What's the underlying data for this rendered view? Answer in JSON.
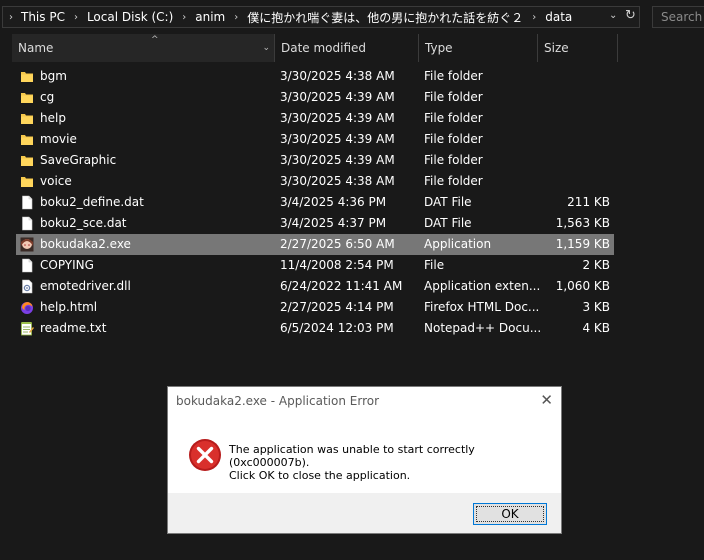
{
  "address": {
    "crumbs": [
      "This PC",
      "Local Disk (C:)",
      "anim",
      "僕に抱かれ喘ぐ妻は、他の男に抱かれた話を紡ぐ２",
      "data"
    ],
    "search_placeholder": "Search d"
  },
  "columns": {
    "name": "Name",
    "date": "Date modified",
    "type": "Type",
    "size": "Size"
  },
  "files": [
    {
      "name": "bgm",
      "date": "3/30/2025 4:38 AM",
      "type": "File folder",
      "size": "",
      "icon": "folder-icon"
    },
    {
      "name": "cg",
      "date": "3/30/2025 4:39 AM",
      "type": "File folder",
      "size": "",
      "icon": "folder-icon"
    },
    {
      "name": "help",
      "date": "3/30/2025 4:39 AM",
      "type": "File folder",
      "size": "",
      "icon": "folder-icon"
    },
    {
      "name": "movie",
      "date": "3/30/2025 4:39 AM",
      "type": "File folder",
      "size": "",
      "icon": "folder-icon"
    },
    {
      "name": "SaveGraphic",
      "date": "3/30/2025 4:39 AM",
      "type": "File folder",
      "size": "",
      "icon": "folder-icon"
    },
    {
      "name": "voice",
      "date": "3/30/2025 4:38 AM",
      "type": "File folder",
      "size": "",
      "icon": "folder-icon"
    },
    {
      "name": "boku2_define.dat",
      "date": "3/4/2025 4:36 PM",
      "type": "DAT File",
      "size": "211 KB",
      "icon": "file-icon"
    },
    {
      "name": "boku2_sce.dat",
      "date": "3/4/2025 4:37 PM",
      "type": "DAT File",
      "size": "1,563 KB",
      "icon": "file-icon"
    },
    {
      "name": "bokudaka2.exe",
      "date": "2/27/2025 6:50 AM",
      "type": "Application",
      "size": "1,159 KB",
      "icon": "app-icon",
      "selected": true
    },
    {
      "name": "COPYING",
      "date": "11/4/2008 2:54 PM",
      "type": "File",
      "size": "2 KB",
      "icon": "file-icon"
    },
    {
      "name": "emotedriver.dll",
      "date": "6/24/2022 11:41 AM",
      "type": "Application exten...",
      "size": "1,060 KB",
      "icon": "dll-icon"
    },
    {
      "name": "help.html",
      "date": "2/27/2025 4:14 PM",
      "type": "Firefox HTML Doc...",
      "size": "3 KB",
      "icon": "firefox-icon"
    },
    {
      "name": "readme.txt",
      "date": "6/5/2024 12:03 PM",
      "type": "Notepad++ Docu...",
      "size": "4 KB",
      "icon": "notepad-icon"
    }
  ],
  "dialog": {
    "title": "bokudaka2.exe - Application Error",
    "message_line1": "The application was unable to start correctly (0xc000007b).",
    "message_line2": "Click OK to close the application.",
    "ok_label": "OK"
  },
  "colors": {
    "background": "#191919",
    "selected_row": "#777777",
    "folder": "#f5c84c",
    "error_red": "#d9302c"
  }
}
